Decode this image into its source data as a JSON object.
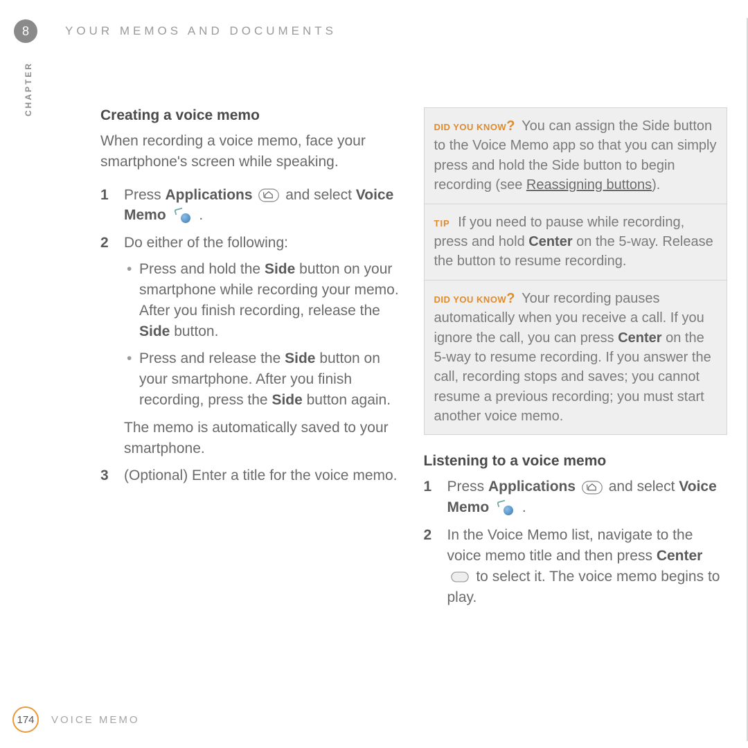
{
  "chapter": {
    "number": "8",
    "label": "CHAPTER"
  },
  "header": {
    "title": "YOUR MEMOS AND DOCUMENTS"
  },
  "left": {
    "title": "Creating a voice memo",
    "intro": "When recording a voice memo, face your smartphone's screen while speaking.",
    "step1": {
      "num": "1",
      "a": "Press ",
      "b": "Applications",
      "c": " and select ",
      "d": "Voice Memo",
      "e": " ."
    },
    "step2": {
      "num": "2",
      "lead": "Do either of the following:",
      "b1a": "Press and hold the ",
      "b1b": "Side",
      "b1c": " button on your smartphone while recording your memo. After you finish recording, release the ",
      "b1d": "Side",
      "b1e": " button.",
      "b2a": "Press and release the ",
      "b2b": "Side",
      "b2c": " button on your smartphone. After you finish recording, press the ",
      "b2d": "Side",
      "b2e": " button again.",
      "tail": "The memo is automatically saved to your smartphone."
    },
    "step3": {
      "num": "3",
      "text": "(Optional)  Enter a title for the voice memo."
    }
  },
  "callouts": {
    "dyk_label_a": "DID YOU KNOW",
    "dyk_label_b": "?",
    "tip_label": "TIP",
    "c1a": " You can assign the Side button to the Voice Memo app so that you can simply press and hold the Side button to begin recording (see ",
    "c1link": "Reassigning buttons",
    "c1b": ").",
    "c2a": " If you need to pause while recording, press and hold ",
    "c2b": "Center",
    "c2c": " on the 5-way. Release the button to resume recording.",
    "c3a": " Your recording pauses automatically when you receive a call. If you ignore the call, you can press ",
    "c3b": "Center",
    "c3c": " on the 5-way to resume recording. If you answer the call, recording stops and saves; you cannot resume a previous recording; you must start another voice memo."
  },
  "right": {
    "title": "Listening to a voice memo",
    "step1": {
      "num": "1",
      "a": "Press ",
      "b": "Applications",
      "c": " and select ",
      "d": "Voice Memo",
      "e": " ."
    },
    "step2": {
      "num": "2",
      "a": "In the Voice Memo list, navigate to the voice memo title and then press ",
      "b": "Center",
      "c": " to select it. The voice memo begins to play."
    }
  },
  "footer": {
    "page": "174",
    "title": "VOICE MEMO"
  }
}
